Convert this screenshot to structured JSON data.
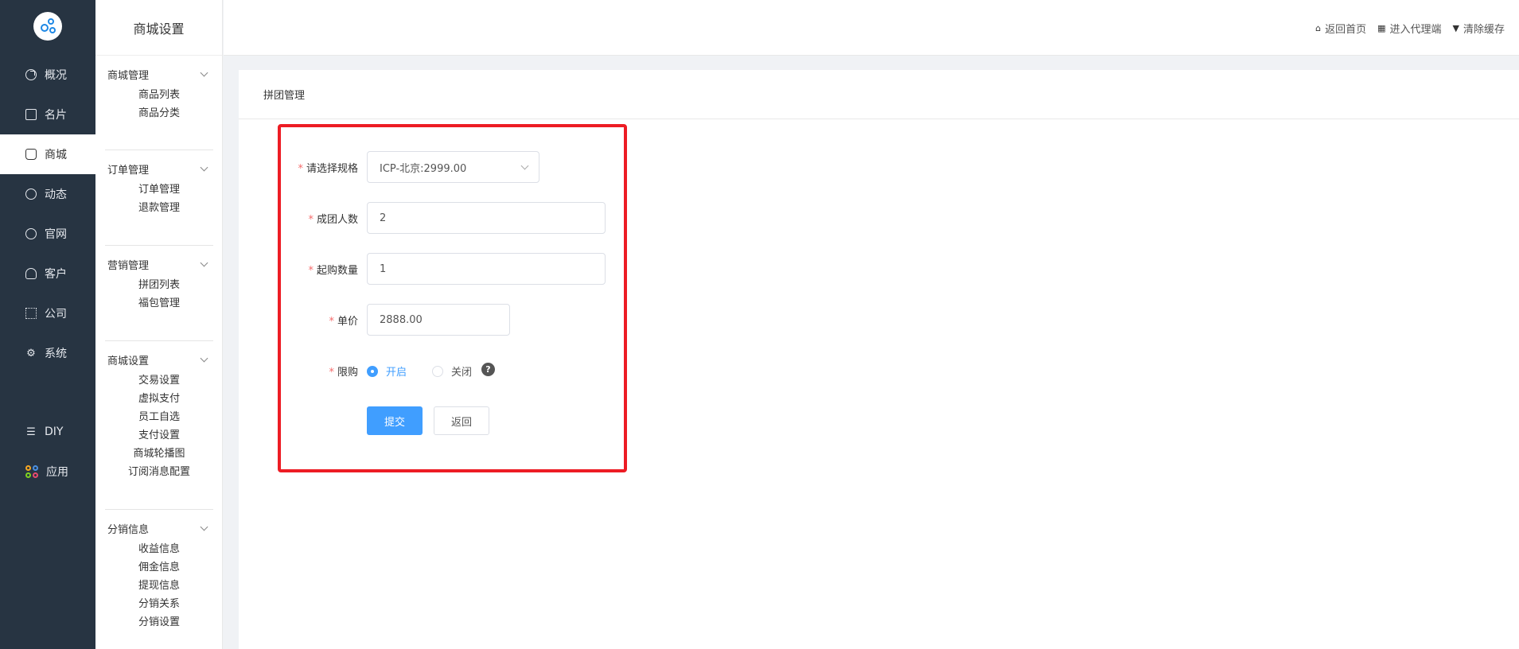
{
  "nav": {
    "items": [
      {
        "label": "概况",
        "icon": "dashboard-icon"
      },
      {
        "label": "名片",
        "icon": "card-icon"
      },
      {
        "label": "商城",
        "icon": "shop-bag-icon"
      },
      {
        "label": "动态",
        "icon": "compass-icon"
      },
      {
        "label": "官网",
        "icon": "globe-icon"
      },
      {
        "label": "客户",
        "icon": "user-icon"
      },
      {
        "label": "公司",
        "icon": "org-icon"
      },
      {
        "label": "系统",
        "icon": "gear-icon"
      },
      {
        "label": "DIY",
        "icon": "diy-icon"
      },
      {
        "label": "应用",
        "icon": "apps-icon"
      }
    ],
    "active": "商城"
  },
  "sidebar": {
    "title": "商城设置",
    "groups": [
      {
        "label": "商城管理",
        "items": [
          "商品列表",
          "商品分类"
        ]
      },
      {
        "label": "订单管理",
        "items": [
          "订单管理",
          "退款管理"
        ]
      },
      {
        "label": "营销管理",
        "items": [
          "拼团列表",
          "福包管理"
        ]
      },
      {
        "label": "商城设置",
        "items": [
          "交易设置",
          "虚拟支付",
          "员工自选",
          "支付设置",
          "商城轮播图",
          "订阅消息配置"
        ]
      },
      {
        "label": "分销信息",
        "items": [
          "收益信息",
          "佣金信息",
          "提现信息",
          "分销关系",
          "分销设置"
        ]
      }
    ]
  },
  "header": {
    "links": [
      {
        "label": "返回首页",
        "icon": "home-icon"
      },
      {
        "label": "进入代理端",
        "icon": "grid-icon"
      },
      {
        "label": "清除缓存",
        "icon": "brush-icon"
      }
    ]
  },
  "panel": {
    "title": "拼团管理"
  },
  "form": {
    "spec": {
      "label": "请选择规格",
      "value": "ICP-北京:2999.00"
    },
    "group_size": {
      "label": "成团人数",
      "value": "2"
    },
    "min_qty": {
      "label": "起购数量",
      "value": "1"
    },
    "unit_price": {
      "label": "单价",
      "value": "2888.00"
    },
    "limit": {
      "label": "限购",
      "options": [
        "开启",
        "关闭"
      ],
      "selected": "开启"
    },
    "help": "?",
    "submit_label": "提交",
    "back_label": "返回"
  },
  "colors": {
    "nav_bg": "#273442",
    "primary": "#409eff",
    "required": "#f56c6c",
    "highlight": "#ed1c24"
  }
}
